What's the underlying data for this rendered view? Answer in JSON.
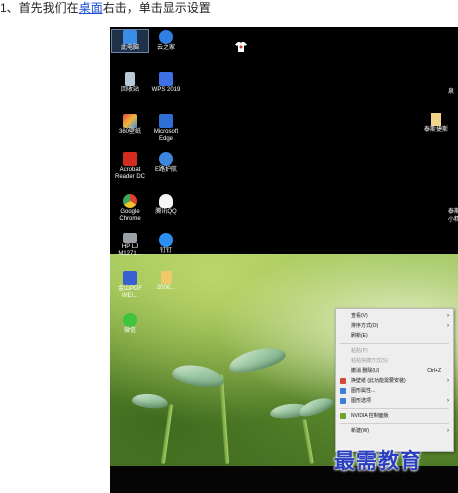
{
  "instruction": {
    "prefix": "1、首先我们在",
    "link": "桌面",
    "suffix": "右击，单击显示设置"
  },
  "desktop": {
    "icons": [
      {
        "label": "此电脑",
        "icon": "this-pc-icon",
        "color": "#3a8ee8"
      },
      {
        "label": "云之家",
        "icon": "yunzhijia-icon",
        "color": "#2f7fe0"
      },
      {
        "label": "回收站",
        "icon": "recycle-bin-icon",
        "color": "#b9c8d6"
      },
      {
        "label": "WPS 2019",
        "icon": "wps-icon",
        "color": "#3f6fe6"
      },
      {
        "label": "360壁纸",
        "icon": "360-wallpaper-icon",
        "color": "#e04a3a"
      },
      {
        "label": "Microsoft Edge",
        "icon": "edge-icon",
        "color": "#2d6fd4"
      },
      {
        "label": "Acrobat Reader DC",
        "icon": "acrobat-icon",
        "color": "#d52b1e"
      },
      {
        "label": "E路护航",
        "icon": "e-luhuhang-icon",
        "color": "#3d86de"
      },
      {
        "label": "Google Chrome",
        "icon": "chrome-icon",
        "color": "#f2c12e"
      },
      {
        "label": "腾讯QQ",
        "icon": "qq-icon",
        "color": "#f5f5f5"
      },
      {
        "label": "HP LJ M1271...",
        "icon": "printer-icon",
        "color": "#9aa0a8"
      },
      {
        "label": "钉钉",
        "icon": "dingtalk-icon",
        "color": "#2b8ef0"
      },
      {
        "label": "金山PDF WEI...",
        "icon": "kingsoft-pdf-icon",
        "color": "#3a5fd0"
      },
      {
        "label": "2006...",
        "icon": "folder-icon",
        "color": "#f0c96a"
      },
      {
        "label": "微信",
        "icon": "wechat-icon",
        "color": "#3ec43e"
      }
    ],
    "right_folder": "泰斯捷斯",
    "right_edge_items": [
      "泉",
      "泰斯",
      "小精"
    ]
  },
  "context_menu": {
    "items": [
      {
        "label": "查看(V)",
        "submenu": true,
        "disabled": false
      },
      {
        "label": "排序方式(O)",
        "submenu": true,
        "disabled": false
      },
      {
        "label": "刷新(E)",
        "submenu": false,
        "disabled": false
      },
      {
        "sep": true
      },
      {
        "label": "粘贴(P)",
        "submenu": false,
        "disabled": true
      },
      {
        "label": "粘贴快捷方式(S)",
        "submenu": false,
        "disabled": true
      },
      {
        "label": "撤消 删除(U)",
        "shortcut": "Ctrl+Z",
        "submenu": false,
        "disabled": false
      },
      {
        "label": "换壁纸 (此功能需要安装)",
        "submenu": true,
        "disabled": false,
        "icon": "wallpaper-icon"
      },
      {
        "label": "图形属性...",
        "submenu": false,
        "disabled": false,
        "icon": "graphics-properties-icon"
      },
      {
        "label": "图形选项",
        "submenu": true,
        "disabled": false,
        "icon": "graphics-options-icon"
      },
      {
        "sep": true
      },
      {
        "label": "NVIDIA 控制面板",
        "submenu": false,
        "disabled": false,
        "icon": "nvidia-icon"
      },
      {
        "sep": true
      },
      {
        "label": "新建(W)",
        "submenu": true,
        "disabled": false
      }
    ]
  },
  "watermark": "最需教育",
  "colors": {
    "link": "#1a4fd6",
    "menu_bg": "#eeeeee",
    "watermark": "#2a3fbf"
  }
}
